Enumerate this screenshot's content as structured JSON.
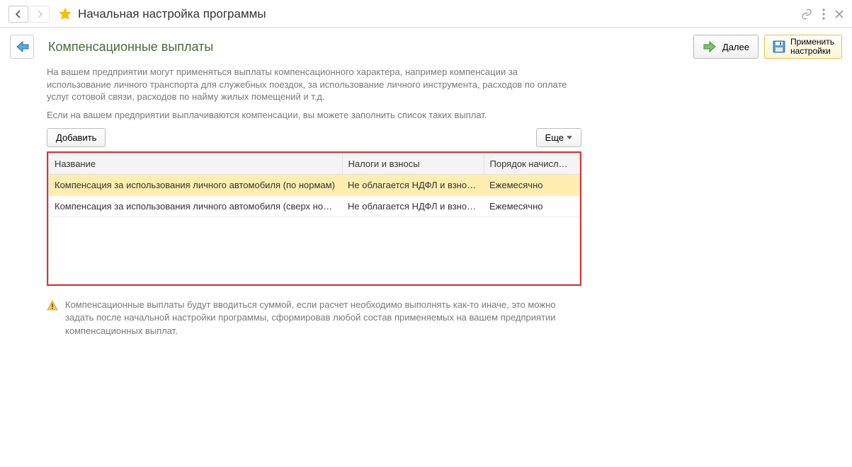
{
  "title": "Начальная настройка программы",
  "heading": "Компенсационные выплаты",
  "toolbar": {
    "next_label": "Далее",
    "apply_line1": "Применить",
    "apply_line2": "настройки"
  },
  "intro": {
    "p1": "На вашем предприятии могут применяться выплаты компенсационного характера, например компенсации за использование личного транспорта для служебных поездок, за использование личного инструмента, расходов по оплате услуг сотовой связи, расходов по найму жилых помещений и т.д.",
    "p2": "Если на вашем предприятии выплачиваются компенсации, вы можете заполнить список таких выплат."
  },
  "table_actions": {
    "add_label": "Добавить",
    "more_label": "Еще"
  },
  "table": {
    "columns": {
      "name": "Название",
      "tax": "Налоги и взносы",
      "order": "Порядок начисл…"
    },
    "rows": [
      {
        "name": "Компенсация за использования личного автомобиля (по нормам)",
        "tax": "Не облагается НДФЛ и взно…",
        "order": "Ежемесячно",
        "selected": true
      },
      {
        "name": "Компенсация за использования личного автомобиля (сверх норм)",
        "tax": "Не облагается НДФЛ и взно…",
        "order": "Ежемесячно",
        "selected": false
      }
    ]
  },
  "footer_note": "Компенсационные выплаты будут вводиться суммой, если расчет необходимо выполнять как-то иначе, это можно задать после начальной настройки программы, сформировав любой состав применяемых на вашем предприятии компенсационных выплат."
}
